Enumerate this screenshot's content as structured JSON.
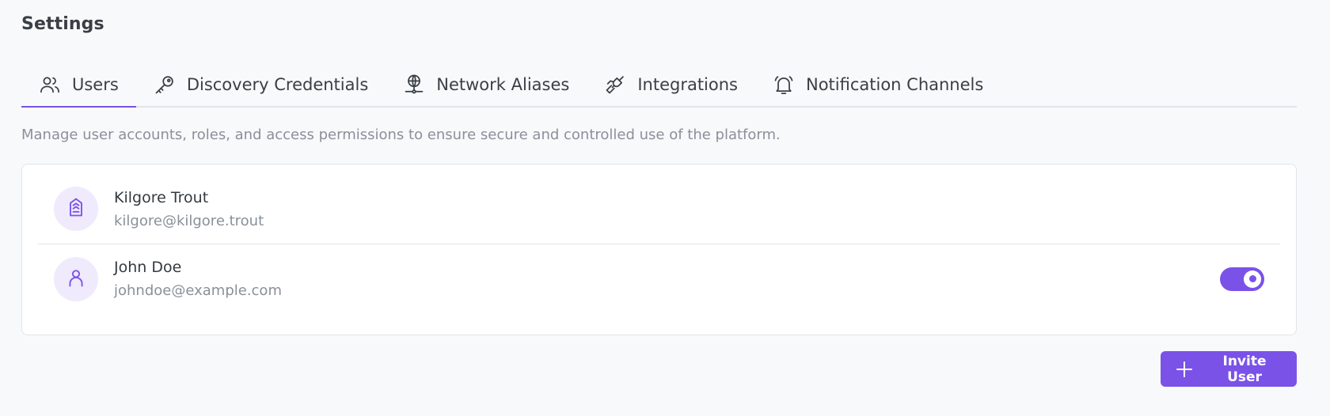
{
  "page": {
    "title": "Settings",
    "description": "Manage user accounts, roles, and access permissions to ensure secure and controlled use of the platform."
  },
  "tabs": [
    {
      "label": "Users",
      "icon": "users-icon",
      "active": true
    },
    {
      "label": "Discovery Credentials",
      "icon": "key-icon",
      "active": false
    },
    {
      "label": "Network Aliases",
      "icon": "network-icon",
      "active": false
    },
    {
      "label": "Integrations",
      "icon": "plug-icon",
      "active": false
    },
    {
      "label": "Notification Channels",
      "icon": "bell-icon",
      "active": false
    }
  ],
  "users": [
    {
      "name": "Kilgore Trout",
      "email": "kilgore@kilgore.trout",
      "avatar_icon": "admin-badge-icon",
      "toggle": null
    },
    {
      "name": "John Doe",
      "email": "johndoe@example.com",
      "avatar_icon": "user-icon",
      "toggle": true
    }
  ],
  "actions": {
    "invite_label": "Invite User"
  },
  "colors": {
    "accent": "#7a52e8",
    "avatar_bg": "#efeafc",
    "muted_text": "#8a9099",
    "border": "#e2e4e8"
  }
}
